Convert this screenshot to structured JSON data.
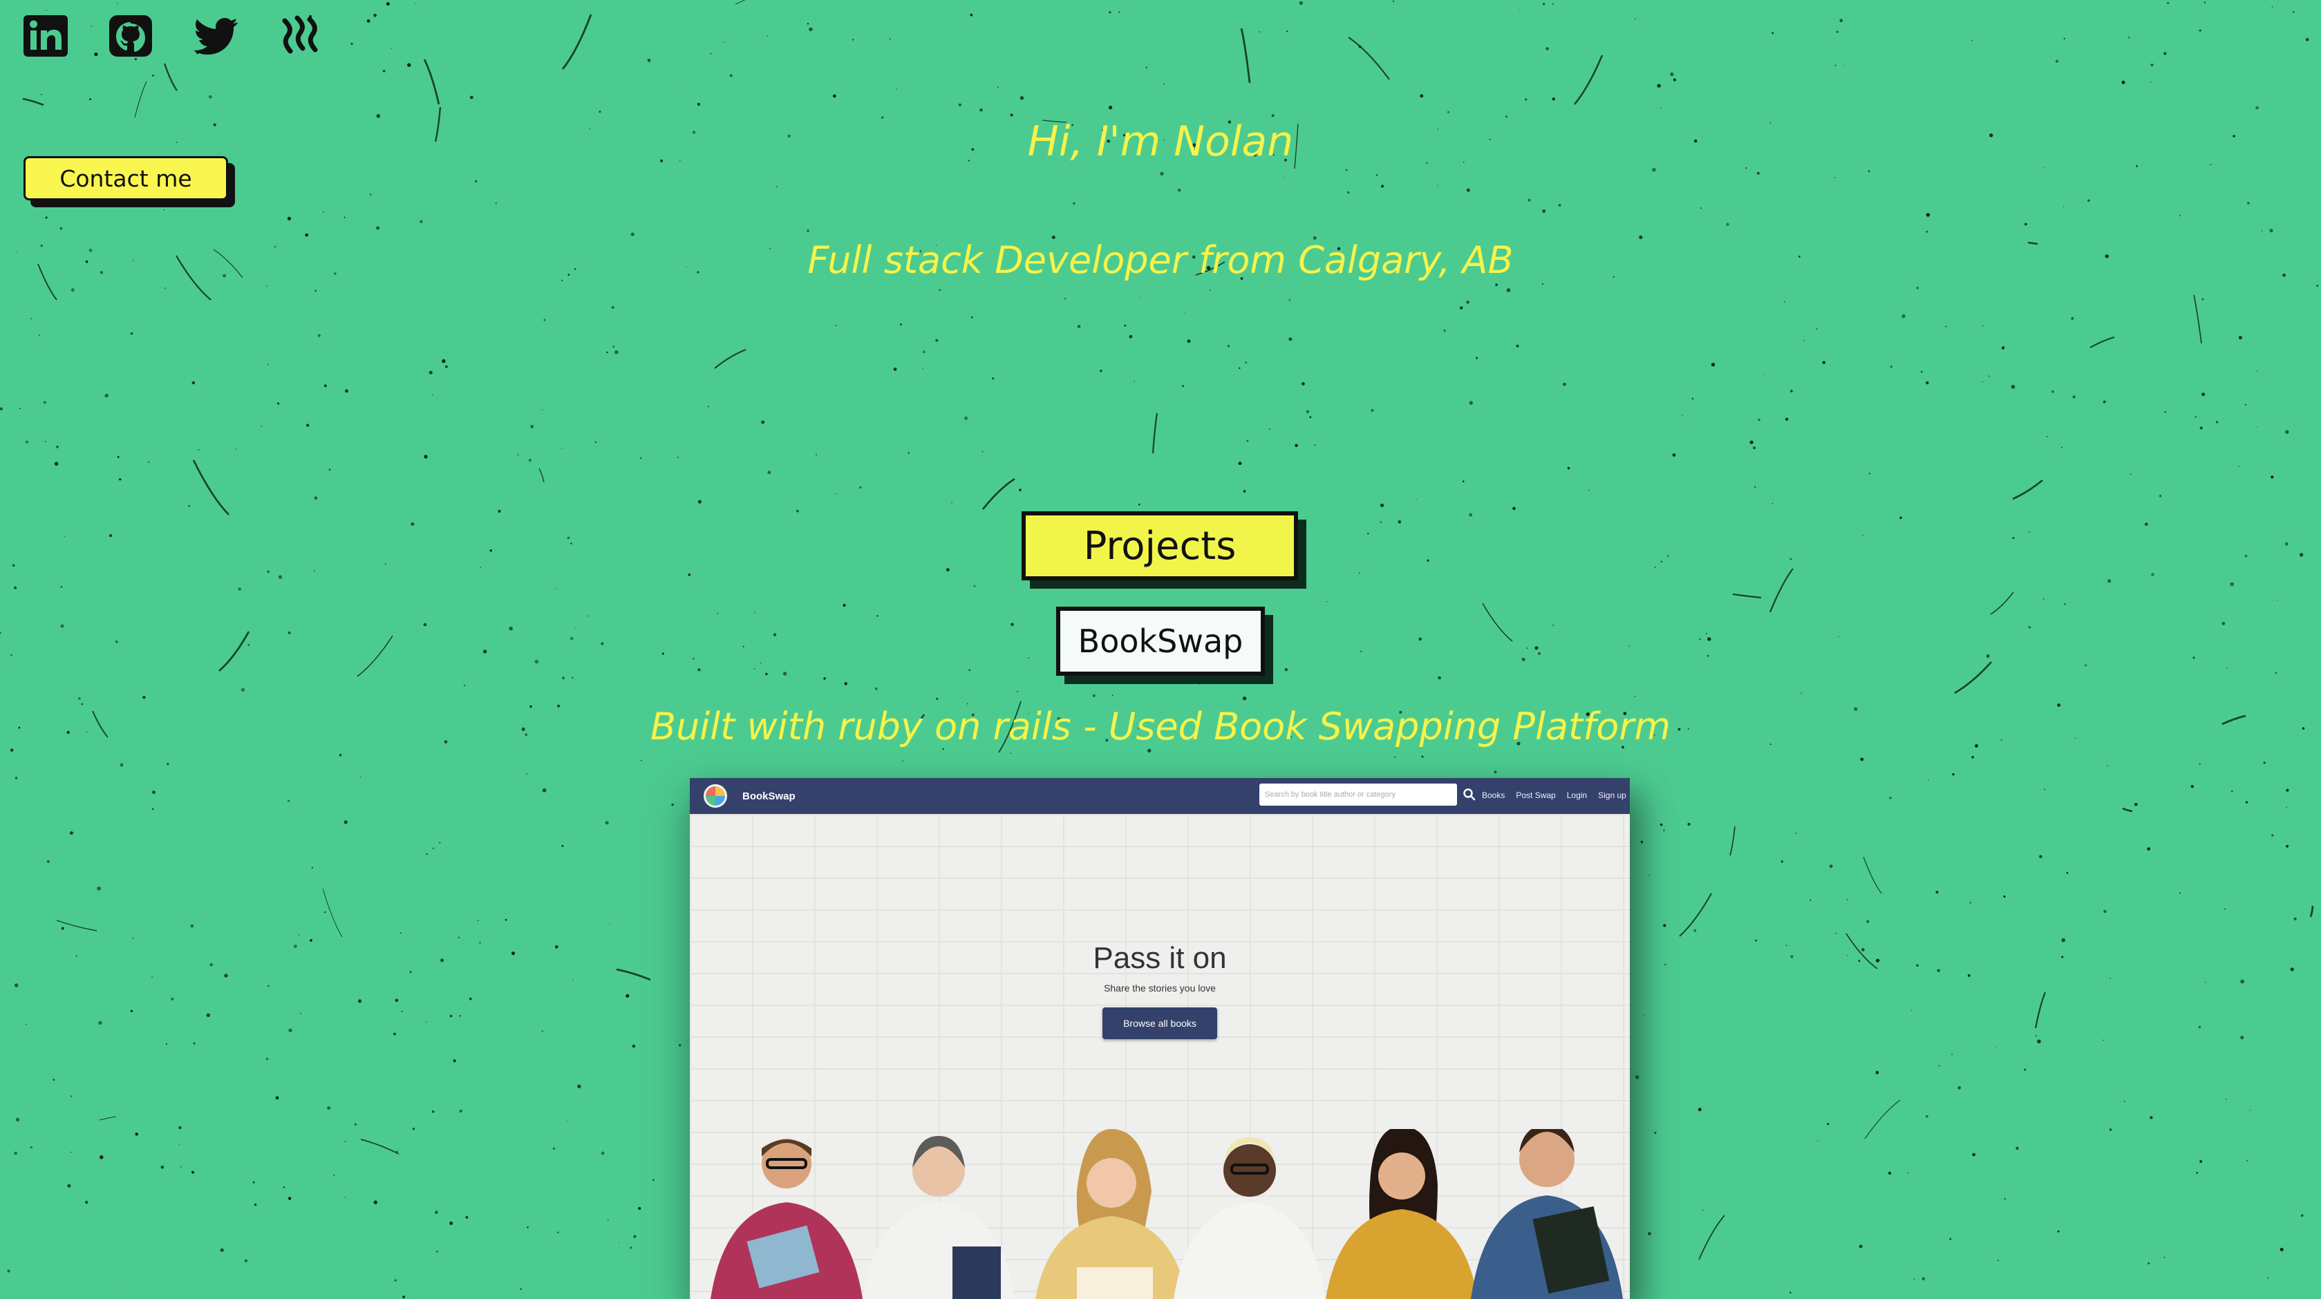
{
  "social": {
    "icons": [
      "linkedin-icon",
      "github-icon",
      "twitter-icon",
      "steemit-icon"
    ]
  },
  "contact": {
    "label": "Contact me"
  },
  "hero": {
    "title": "Hi, I'm Nolan",
    "subtitle": "Full stack Developer from Calgary, AB"
  },
  "projects": {
    "heading": "Projects",
    "items": [
      {
        "name": "BookSwap",
        "description": "Built with ruby on rails - Used Book Swapping Platform",
        "screenshot": {
          "brand": "BookSwap",
          "search_placeholder": "Search by book title author or category",
          "nav_links": [
            "Books",
            "Post Swap",
            "Login",
            "Sign up"
          ],
          "hero_title": "Pass it on",
          "hero_subtitle": "Share the stories you love",
          "hero_button": "Browse all books"
        }
      }
    ]
  },
  "colors": {
    "background": "#4ccb91",
    "accent_yellow": "#f6f34a",
    "navy": "#34416b"
  }
}
